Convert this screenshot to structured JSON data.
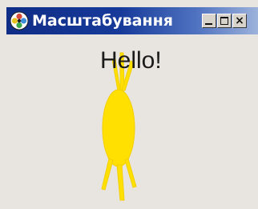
{
  "window": {
    "title": "Масштабування",
    "icon": "app-flower-icon",
    "buttons": [
      "minimize-icon",
      "maximize-icon",
      "close-icon"
    ],
    "close_glyph": "×"
  },
  "content": {
    "greeting": "Hello!",
    "sprite": "yellow-bug-icon"
  },
  "colors": {
    "titlebar_start": "#0f2d86",
    "titlebar_end": "#9fb4dc",
    "sprite": "#ffe000",
    "background": "#e8e5e0"
  }
}
